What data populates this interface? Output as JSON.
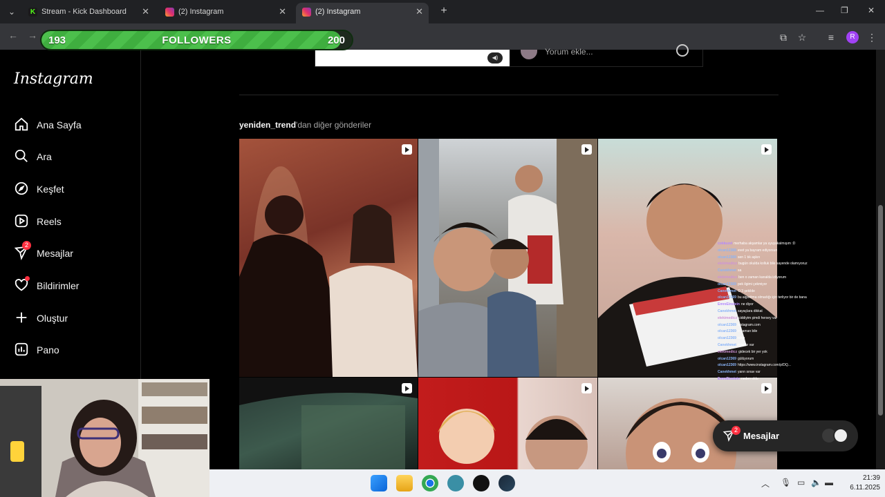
{
  "browser": {
    "tabs": [
      {
        "title": "Stream - Kick Dashboard",
        "favicon": "kick-icon",
        "active": false
      },
      {
        "title": "(2) Instagram",
        "favicon": "instagram-icon",
        "active": false
      },
      {
        "title": "(2) Instagram",
        "favicon": "instagram-icon",
        "active": true
      }
    ],
    "new_tab_glyph": "+",
    "profile_initial": "R"
  },
  "followers_goal": {
    "current": "193",
    "label": "FOLLOWERS",
    "goal": "200",
    "progress": 0.965
  },
  "sidebar": {
    "logo": "Instagram",
    "items": [
      {
        "label": "Ana Sayfa",
        "icon": "home-icon"
      },
      {
        "label": "Ara",
        "icon": "search-icon"
      },
      {
        "label": "Keşfet",
        "icon": "compass-icon"
      },
      {
        "label": "Reels",
        "icon": "reels-icon"
      },
      {
        "label": "Mesajlar",
        "icon": "messenger-icon",
        "badge": "2"
      },
      {
        "label": "Bildirimler",
        "icon": "heart-icon"
      },
      {
        "label": "Oluştur",
        "icon": "plus-icon"
      },
      {
        "label": "Pano",
        "icon": "dashboard-icon"
      }
    ]
  },
  "post": {
    "comment_placeholder": "Yorum ekle..."
  },
  "more_posts": {
    "username": "yeniden_trend",
    "suffix": "'dan diğer gönderiler"
  },
  "chat": [
    {
      "user": "cokkuzel",
      "color": "#b388ff",
      "text": "merhaba akşamlar ya uyuyakalmışım :D"
    },
    {
      "user": "olcan12369",
      "color": "#8ab4f8",
      "text": "evet ya bayram ediyorsun"
    },
    {
      "user": "olcan12369",
      "color": "#8ab4f8",
      "text": "sen 1 tık aşkın"
    },
    {
      "user": "elekimedicz",
      "color": "#ce93d8",
      "text": "bugün okulda kolluk bile sayende olamıyoruz"
    },
    {
      "user": "Canekhmet",
      "color": "#8ab4f8",
      "text": "sa"
    },
    {
      "user": "elekimedicz",
      "color": "#ce93d8",
      "text": "ben o zaman kanalda izliyorum"
    },
    {
      "user": "olcan12369",
      "color": "#8ab4f8",
      "text": "pek ilgimi çekmiyor"
    },
    {
      "user": "Canekhmet",
      "color": "#8ab4f8",
      "text": "O 3 şekilde"
    },
    {
      "user": "olcan12369",
      "color": "#8ab4f8",
      "text": "bu algoritma olmadığı için terliyor bir de bana"
    },
    {
      "user": "EmreEinstein",
      "color": "#b388ff",
      "text": "ne diyor"
    },
    {
      "user": "Canekhmet",
      "color": "#8ab4f8",
      "text": "sayaçlara dikkat"
    },
    {
      "user": "elekimedicz",
      "color": "#ce93d8",
      "text": "ciddiyim şimdi hersey var"
    },
    {
      "user": "olcan12369",
      "color": "#8ab4f8",
      "text": "instagram.com"
    },
    {
      "user": "olcan12369",
      "color": "#8ab4f8",
      "text": "o zaman bile"
    },
    {
      "user": "olcan12369",
      "color": "#8ab4f8",
      "text": "olayı"
    },
    {
      "user": "Canekhmet",
      "color": "#8ab4f8",
      "text": "madde var"
    },
    {
      "user": "elekimedicz",
      "color": "#ce93d8",
      "text": "gidecek bir yer yok"
    },
    {
      "user": "olcan12369",
      "color": "#8ab4f8",
      "text": "gülüyorum"
    },
    {
      "user": "olcan12369",
      "color": "#8ab4f8",
      "text": "https://www.instagram.com/p/DQ..."
    },
    {
      "user": "Canekhmet",
      "color": "#8ab4f8",
      "text": "yarın sınav var"
    },
    {
      "user": "EmreEinstein",
      "color": "#b388ff",
      "text": "neden oldu"
    }
  ],
  "messages_popup": {
    "label": "Mesajlar",
    "badge": "2"
  },
  "taskbar": {
    "time": "21:39",
    "date": "6.11.2025"
  }
}
